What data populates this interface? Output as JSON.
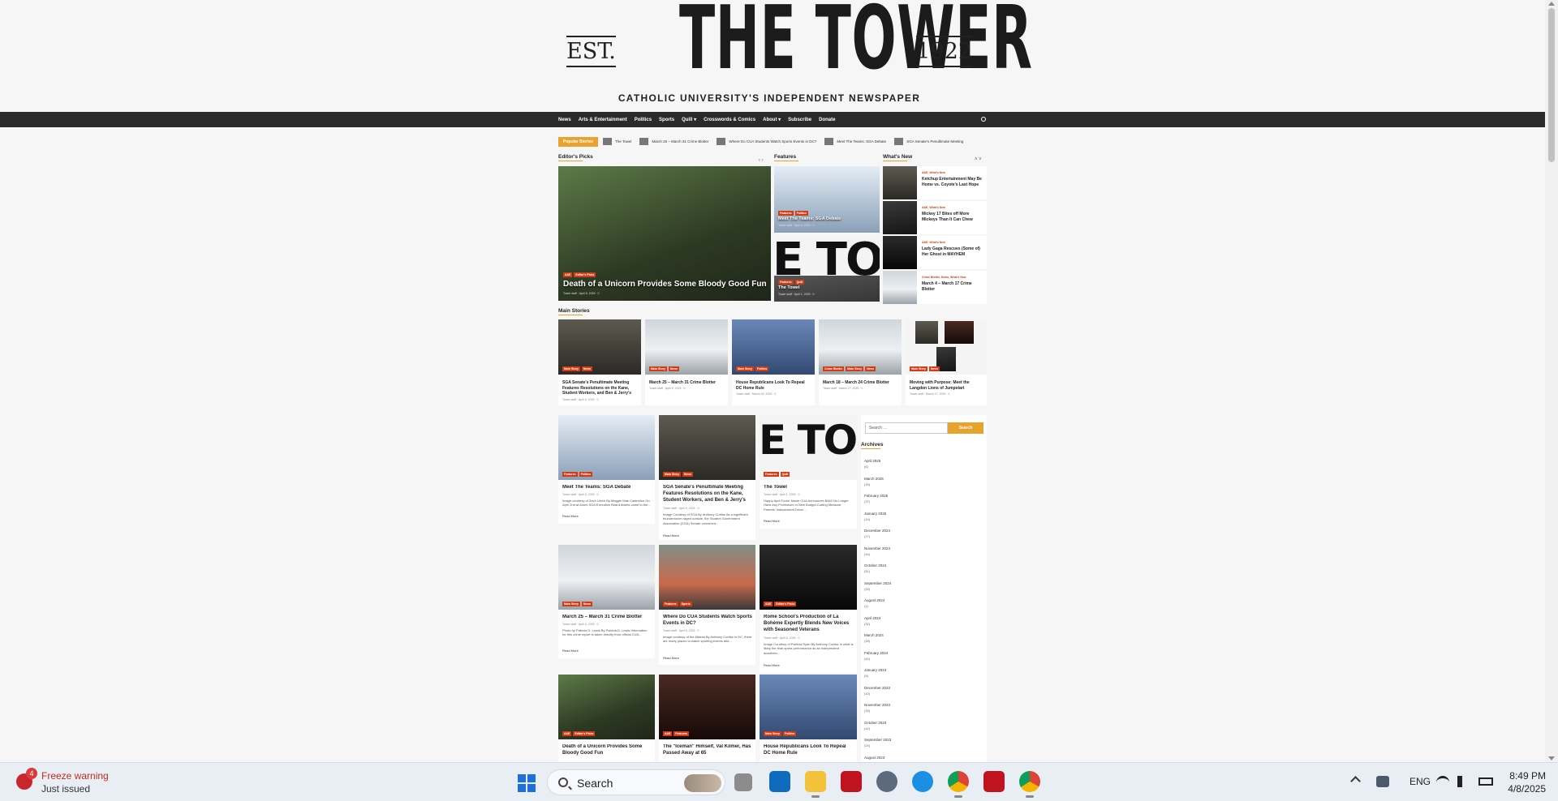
{
  "site": {
    "est": "EST.",
    "name": "THE TOWER",
    "year": "1922",
    "tagline": "CATHOLIC UNIVERSITY'S INDEPENDENT NEWSPAPER"
  },
  "nav": [
    "News",
    "Arts & Entertainment",
    "Politics",
    "Sports",
    "Quill ▾",
    "Crosswords & Comics",
    "About ▾",
    "Subscribe",
    "Donate"
  ],
  "ticker": {
    "label": "Popular Stories",
    "items": [
      "The Towel",
      "March 25 – March 31 Crime Blotter",
      "Where Do CUA Students Watch Sports Events in DC?",
      "Meet The Teams: SGA Debate",
      "SGA Senate's Penultimate Meeting"
    ]
  },
  "sections": {
    "editors_picks": "Editor's Picks",
    "features": "Features",
    "whats_new": "What's New",
    "main_stories": "Main Stories"
  },
  "editors_pick": {
    "title": "Death of a Unicorn Provides Some Bloody Good Fun",
    "cats": [
      "A&E",
      "Editor's Picks"
    ],
    "meta": "Tower staff  ·  April 6, 2025  ·  0"
  },
  "features": [
    {
      "title": "Meet The Teams: SGA Debate",
      "cats": [
        "Features",
        "Politics"
      ],
      "meta": "Tower staff  ·  April 6, 2025  ·  0"
    },
    {
      "title": "The Towel",
      "cats": [
        "Features",
        "Quill"
      ],
      "meta": "Tower staff  ·  April 1, 2025  ·  0"
    }
  ],
  "whats_new": [
    {
      "cat": "A&E, What's New",
      "title": "Ketchup Entertainment May Be Home vs. Coyote's Last Hope"
    },
    {
      "cat": "A&E, What's New",
      "title": "Mickey 17 Bites off More Mickeys Than It Can Chew"
    },
    {
      "cat": "A&E, What's New",
      "title": "Lady Gaga Rescues (Some of) Her Ghost in MAYHEM"
    },
    {
      "cat": "Crime Blotter, News, What's New",
      "title": "March 4 – March 17 Crime Blotter"
    }
  ],
  "main_stories": [
    {
      "title": "SGA Senate's Penultimate Meeting Features Resolutions on the Kane, Student Workers, and Ben & Jerry's",
      "cats": [
        "Main Story",
        "News"
      ],
      "meta": "Tower staff  ·  April 6, 2025  ·  0"
    },
    {
      "title": "March 25 – March 31 Crime Blotter",
      "cats": [
        "Main Story",
        "News"
      ],
      "meta": "Tower staff  ·  April 6, 2025  ·  0"
    },
    {
      "title": "House Republicans Look To Repeal DC Home Rule",
      "cats": [
        "Main Story",
        "Politics"
      ],
      "meta": "Tower staff  ·  March 30, 2025  ·  0"
    },
    {
      "title": "March 18 – March 24 Crime Blotter",
      "cats": [
        "Crime Blotter",
        "Main Story",
        "News"
      ],
      "meta": "Tower staff  ·  March 27, 2025  ·  0"
    },
    {
      "title": "Moving with Purpose: Meet the Langdon Lions of Jumpstart",
      "cats": [
        "Main Story",
        "News"
      ],
      "meta": "Tower staff  ·  March 27, 2025  ·  0"
    }
  ],
  "grid": [
    {
      "title": "Meet The Teams: SGA Debate",
      "cats": [
        "Features",
        "Politics"
      ],
      "meta": "Tower staff  ·  April 6, 2025  ·  0",
      "excerpt": "Image courtesy of Zach Ulrich By Maggie Mae Castrellon On April 2nd at Ames SGA Executive Board tickets came to the...",
      "read": "Read More"
    },
    {
      "title": "SGA Senate's Penultimate Meeting Features Resolutions on the Kane, Student Workers, and Ben & Jerry's",
      "cats": [
        "Main Story",
        "News"
      ],
      "meta": "Tower staff  ·  April 6, 2025  ·  0",
      "excerpt": "Image Courtesy of SGA By Anthony Curtiss As a significant thunderstorm raged outside, the Student Government Association (SGA) Senate convened...",
      "read": "Read More"
    },
    {
      "title": "The Towel",
      "cats": [
        "Features",
        "Quill"
      ],
      "meta": "Tower staff  ·  April 1, 2025  ·  0",
      "excerpt": "Happy April Fools! Name CUA Announces BAN! No Longer Have Any Professors In New Budget-Cutting Measure, Parents' Independent Drive!...",
      "read": "Read More"
    },
    {
      "title": "March 25 – March 31 Crime Blotter",
      "cats": [
        "Main Story",
        "News"
      ],
      "meta": "Tower staff  ·  April 6, 2025  ·  0",
      "excerpt": "Photo by Patricia D. Lewis By Patricia D. Lewis Information for this crime report is taken directly from official CUA...",
      "read": "Read More"
    },
    {
      "title": "Where Do CUA Students Watch Sports Events in DC?",
      "cats": [
        "Features",
        "Sports"
      ],
      "meta": "Tower staff  ·  April 6, 2025  ·  0",
      "excerpt": "Image courtesy of the Atlanta By Anthony Curtiss In DC, there are many places to watch sporting events and...",
      "read": "Read More"
    },
    {
      "title": "Rome School's Production of La Bohème Expertly Blends New Voices with Seasoned Veterans",
      "cats": [
        "A&E",
        "Editor's Picks"
      ],
      "meta": "Tower staff  ·  April 6, 2025  ·  0",
      "excerpt": "Image Courtesy of Patricia Ryan By Anthony Curtiss In what is likely the final opera performance as an independent academic...",
      "read": "Read More"
    },
    {
      "title": "Death of a Unicorn Provides Some Bloody Good Fun",
      "cats": [
        "A&E",
        "Editor's Picks"
      ],
      "meta": "Tower staff  ·  April 6, 2025  ·  0",
      "excerpt": "",
      "read": ""
    },
    {
      "title": "The \"Iceman\" Himself, Val Kilmer, Has Passed Away at 65",
      "cats": [
        "A&E",
        "Features"
      ],
      "meta": "Tower staff  ·  April 6, 2025  ·  0",
      "excerpt": "",
      "read": ""
    },
    {
      "title": "House Republicans Look To Repeal DC Home Rule",
      "cats": [
        "Main Story",
        "Politics"
      ],
      "meta": "Tower staff  ·  March 30, 2025  ·  0",
      "excerpt": "",
      "read": ""
    }
  ],
  "sidebar": {
    "search_placeholder": "Search …",
    "search_button": "Search",
    "archives_heading": "Archives",
    "archives": [
      {
        "month": "April 2025",
        "count": "(6)"
      },
      {
        "month": "March 2025",
        "count": "(33)"
      },
      {
        "month": "February 2025",
        "count": "(37)"
      },
      {
        "month": "January 2025",
        "count": "(14)"
      },
      {
        "month": "December 2024",
        "count": "(17)"
      },
      {
        "month": "November 2024",
        "count": "(44)"
      },
      {
        "month": "October 2024",
        "count": "(51)"
      },
      {
        "month": "September 2024",
        "count": "(33)"
      },
      {
        "month": "August 2024",
        "count": "(1)"
      },
      {
        "month": "April 2024",
        "count": "(32)"
      },
      {
        "month": "March 2024",
        "count": "(18)"
      },
      {
        "month": "February 2024",
        "count": "(44)"
      },
      {
        "month": "January 2024",
        "count": "(5)"
      },
      {
        "month": "December 2023",
        "count": "(10)"
      },
      {
        "month": "November 2023",
        "count": "(33)"
      },
      {
        "month": "October 2023",
        "count": "(42)"
      },
      {
        "month": "September 2023",
        "count": "(24)"
      },
      {
        "month": "August 2023",
        "count": ""
      }
    ]
  },
  "taskbar": {
    "notif_count": "4",
    "notif_title": "Freeze warning",
    "notif_sub": "Just issued",
    "search_label": "Search",
    "lang": "ENG",
    "time": "8:49 PM",
    "date": "4/8/2025"
  },
  "colors": {
    "accent": "#e8a22e",
    "category": "#d03c16",
    "nav_bg": "#2a2a2a"
  }
}
